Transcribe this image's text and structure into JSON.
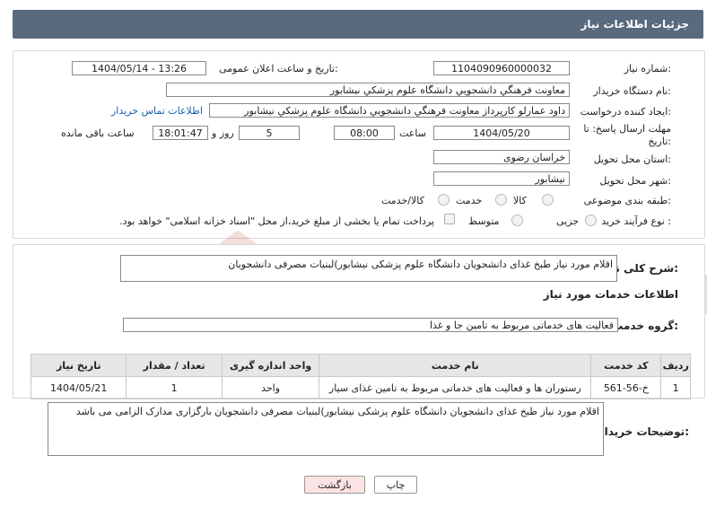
{
  "header": {
    "title": "جزئیات اطلاعات نیاز"
  },
  "form": {
    "need_number": {
      "label": "شماره نیاز:",
      "value": "1104090960000032"
    },
    "announce_date": {
      "label": "تاریخ و ساعت اعلان عمومی:",
      "value": "1404/05/14 - 13:26"
    },
    "buyer_org": {
      "label": "نام دستگاه خریدار:",
      "value": "معاونت فرهنگي دانشجويي دانشگاه علوم پزشکي نيشابور"
    },
    "requester": {
      "label": "ایجاد کننده درخواست:",
      "value": "داود عمارلو کارپرداز معاونت فرهنگي دانشجويي دانشگاه علوم پزشکي نيشابور"
    },
    "contact_link": "اطلاعات تماس خریدار",
    "deadline": {
      "label_line1": "مهلت ارسال پاسخ: تا",
      "label_line2": "تاریخ:",
      "date": "1404/05/20",
      "time_label": "ساعت",
      "time": "08:00",
      "days": "5",
      "days_label": "روز و",
      "remaining": "18:01:47",
      "remaining_label": "ساعت باقی مانده"
    },
    "province": {
      "label": "استان محل تحویل:",
      "value": "خراسان رضوی"
    },
    "city": {
      "label": "شهر محل تحویل:",
      "value": "نیشابور"
    },
    "category": {
      "label": "طبقه بندی موضوعی:",
      "options": [
        "کالا",
        "خدمت",
        "کالا/خدمت"
      ]
    },
    "purchase_process": {
      "label": "نوع فرآیند خرید :",
      "options": [
        "جزیی",
        "متوسط"
      ],
      "treasury_note": "پرداخت تمام یا بخشی از مبلغ خرید،از محل \"اسناد خزانه اسلامی\" خواهد بود."
    }
  },
  "summary": {
    "label": "شرح کلی نیاز:",
    "value": "اقلام مورد نیاز طبخ غذای دانشجویان دانشگاه علوم پزشکی نیشابور)لبنیات مصرفی دانشجویان"
  },
  "services": {
    "section_title": "اطلاعات خدمات مورد نیاز",
    "group_label": "گروه خدمت:",
    "group_value": "فعالیت های خدماتی مربوط به تامین جا و غذا",
    "table": {
      "headers": [
        "ردیف",
        "کد خدمت",
        "نام خدمت",
        "واحد اندازه گیری",
        "تعداد / مقدار",
        "تاریخ نیاز"
      ],
      "rows": [
        [
          "1",
          "خ-56-561",
          "رستوران ها و فعالیت های خدماتی مربوط به تامین غذای سیار",
          "واحد",
          "1",
          "1404/05/21"
        ]
      ]
    }
  },
  "buyer_notes": {
    "label": "توضیحات خریدار:",
    "value": "اقلام مورد نیاز طبخ غذای دانشجویان دانشگاه علوم پزشکی نیشابور)لبنیات مصرفی دانشجویان بارگزاری مدارک الزامی می باشد"
  },
  "buttons": {
    "print": "چاپ",
    "back": "بازگشت"
  },
  "watermark": {
    "text": "AriaTender.net"
  },
  "colors": {
    "header_bg": "#5a6a7e",
    "back_btn_bg": "#fbe3e3",
    "link": "#1a5fb4"
  }
}
